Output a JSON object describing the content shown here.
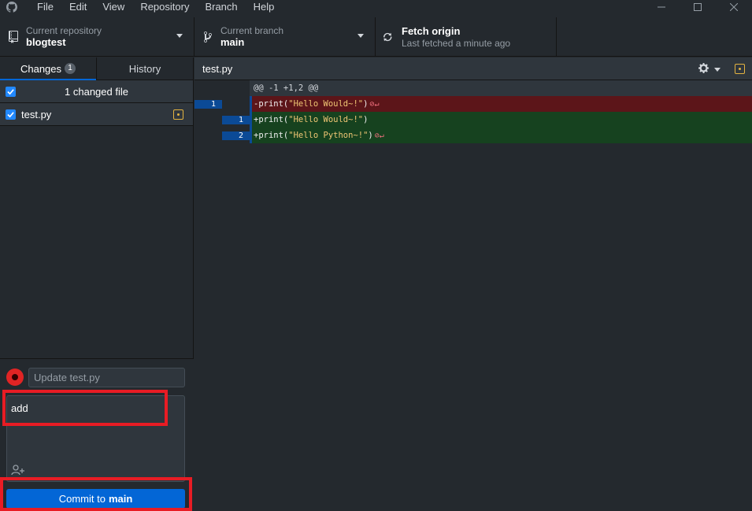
{
  "menu": [
    "File",
    "Edit",
    "View",
    "Repository",
    "Branch",
    "Help"
  ],
  "toolbar": {
    "repo_label": "Current repository",
    "repo_value": "blogtest",
    "branch_label": "Current branch",
    "branch_value": "main",
    "fetch_label": "Fetch origin",
    "fetch_sub": "Last fetched a minute ago"
  },
  "tabs": {
    "changes_label": "Changes",
    "changes_count": "1",
    "history_label": "History"
  },
  "changes": {
    "summary": "1 changed file",
    "files": [
      {
        "name": "test.py",
        "status": "modified"
      }
    ]
  },
  "commit": {
    "summary_placeholder": "Update test.py",
    "description": "add",
    "button_prefix": "Commit to",
    "button_branch": "main"
  },
  "diff": {
    "filename": "test.py",
    "hunk": "@@ -1 +1,2 @@",
    "lines": [
      {
        "type": "del",
        "old": "1",
        "new": "",
        "prefix": "-print(",
        "string": "\"Hello Would~!\"",
        "suffix": ")",
        "no_newline": true
      },
      {
        "type": "add",
        "old": "",
        "new": "1",
        "prefix": "+print(",
        "string": "\"Hello Would~!\"",
        "suffix": ")",
        "no_newline": false
      },
      {
        "type": "add",
        "old": "",
        "new": "2",
        "prefix": "+print(",
        "string": "\"Hello Python~!\"",
        "suffix": ")",
        "no_newline": true
      }
    ]
  },
  "colors": {
    "accent": "#0366d6",
    "highlight_red": "#e81c24",
    "modified": "#e3b341",
    "deleted_bg": "#5c1519",
    "added_bg": "#16421f"
  }
}
